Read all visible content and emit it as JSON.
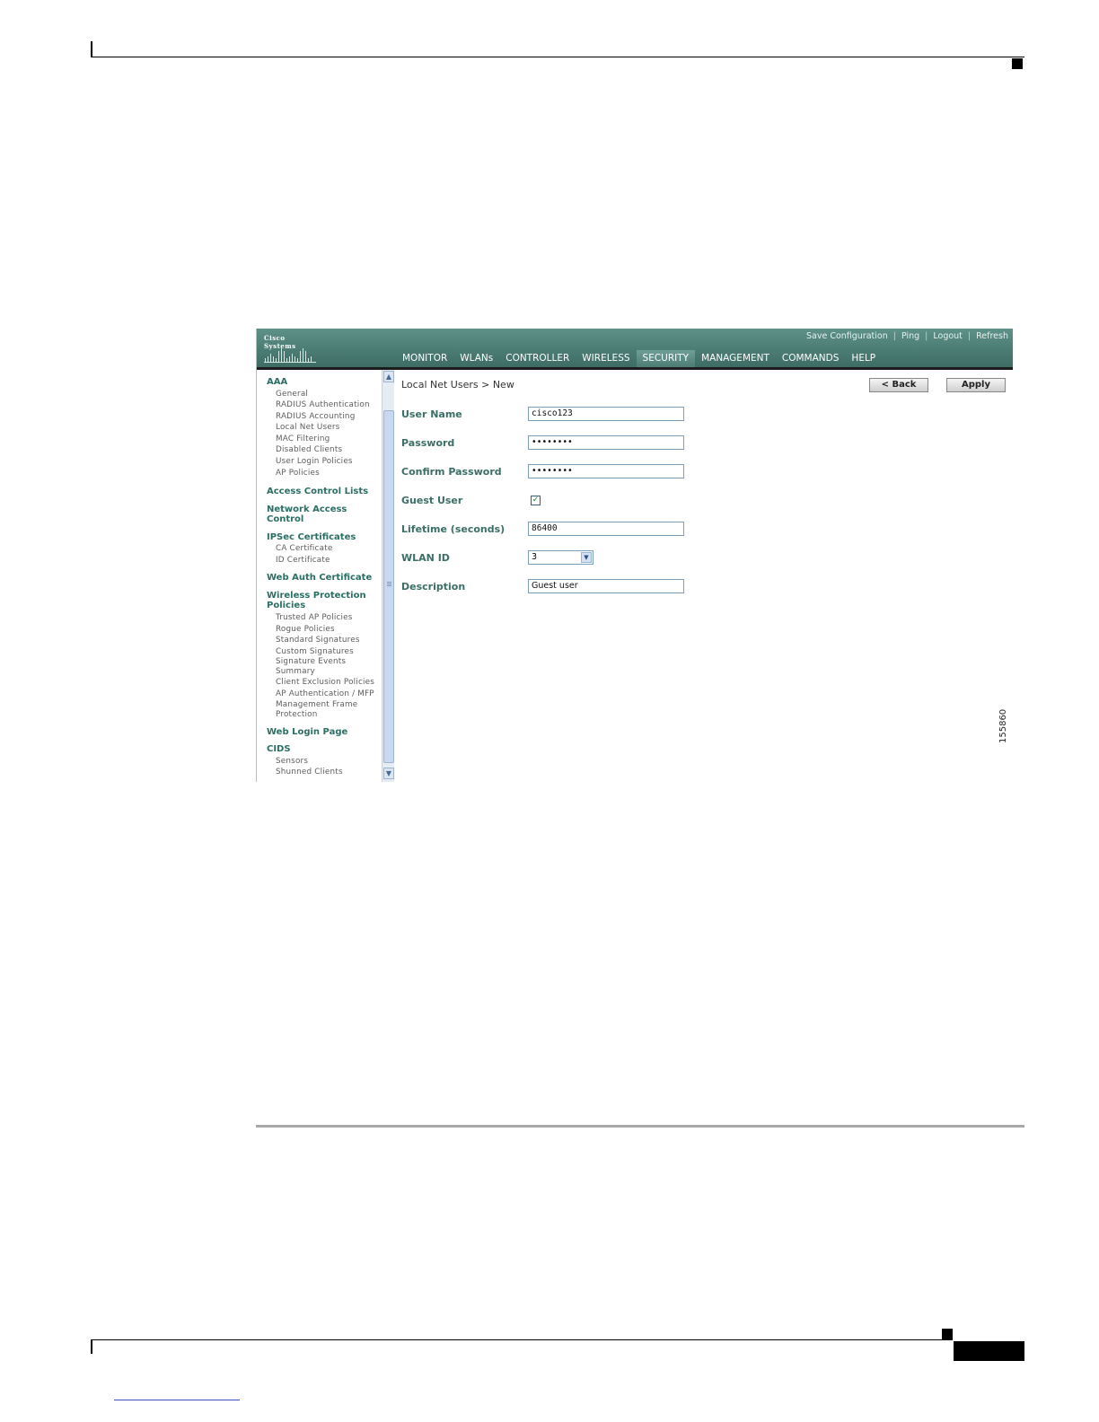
{
  "header": {
    "links": [
      "Save Configuration",
      "Ping",
      "Logout",
      "Refresh"
    ]
  },
  "logo": {
    "text": "Cisco Systems"
  },
  "nav": {
    "items": [
      "MONITOR",
      "WLANs",
      "CONTROLLER",
      "WIRELESS",
      "SECURITY",
      "MANAGEMENT",
      "COMMANDS",
      "HELP"
    ],
    "active": "SECURITY"
  },
  "sidebar": {
    "sections": [
      {
        "title": "AAA",
        "items": [
          "General",
          "RADIUS Authentication",
          "RADIUS Accounting",
          "Local Net Users",
          "MAC Filtering",
          "Disabled Clients",
          "User Login Policies",
          "AP Policies"
        ]
      },
      {
        "title": "Access Control Lists",
        "items": []
      },
      {
        "title": "Network Access Control",
        "items": []
      },
      {
        "title": "IPSec Certificates",
        "items": [
          "CA Certificate",
          "ID Certificate"
        ]
      },
      {
        "title": "Web Auth Certificate",
        "items": []
      },
      {
        "title": "Wireless Protection Policies",
        "items": [
          "Trusted AP Policies",
          "Rogue Policies",
          "Standard Signatures",
          "Custom Signatures",
          "Signature Events Summary",
          "Client Exclusion Policies",
          "AP Authentication / MFP",
          "Management Frame Protection"
        ]
      },
      {
        "title": "Web Login Page",
        "items": []
      },
      {
        "title": "CIDS",
        "items": [
          "Sensors",
          "Shunned Clients"
        ]
      }
    ]
  },
  "page": {
    "breadcrumb": "Local Net Users > New",
    "back_label": "< Back",
    "apply_label": "Apply"
  },
  "form": {
    "user_name_label": "User Name",
    "user_name_value": "cisco123",
    "password_label": "Password",
    "password_value": "••••••••",
    "confirm_label": "Confirm Password",
    "confirm_value": "••••••••",
    "guest_label": "Guest User",
    "guest_checked": true,
    "lifetime_label": "Lifetime (seconds)",
    "lifetime_value": "86400",
    "wlan_label": "WLAN ID",
    "wlan_value": "3",
    "description_label": "Description",
    "description_value": "Guest user"
  },
  "figure_number": "155860"
}
